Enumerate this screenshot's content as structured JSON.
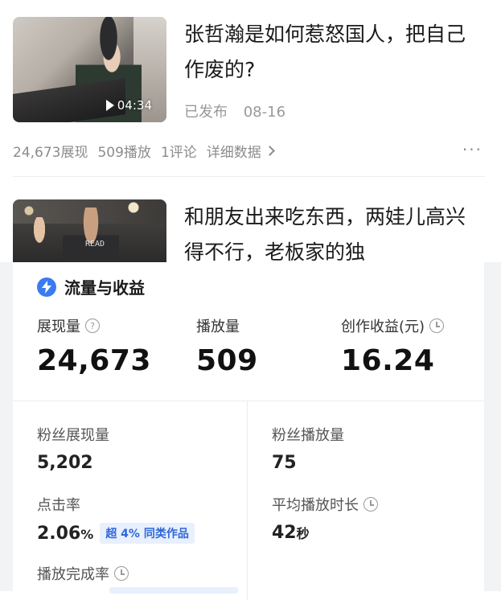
{
  "videos": [
    {
      "title": "张哲瀚是如何惹怒国人，把自己作废的?",
      "duration": "04:34",
      "status": "已发布",
      "date": "08-16",
      "stats": {
        "impressions": "24,673展现",
        "plays": "509播放",
        "comments": "1评论",
        "detail_link": "详细数据"
      },
      "more": "···"
    },
    {
      "title": "和朋友出来吃东西，两娃儿高兴得不行，老板家的独",
      "thumb_text": "READ"
    }
  ],
  "card": {
    "title": "流量与收益",
    "metrics": [
      {
        "label": "展现量",
        "value": "24,673",
        "icon": "help-circle-icon"
      },
      {
        "label": "播放量",
        "value": "509"
      },
      {
        "label": "创作收益(元)",
        "value": "16.24",
        "icon": "clock-icon"
      }
    ],
    "fan_impressions": {
      "label": "粉丝展现量",
      "value": "5,202"
    },
    "fan_plays": {
      "label": "粉丝播放量",
      "value": "75"
    },
    "ctr": {
      "label": "点击率",
      "value": "2.06",
      "unit": "%",
      "badge": "超 4% 同类作品"
    },
    "avg_play_time": {
      "label": "平均播放时长",
      "value": "42",
      "unit": "秒",
      "icon": "clock-icon"
    },
    "completion_rate": {
      "label": "播放完成率",
      "icon": "clock-icon"
    }
  },
  "colors": {
    "accent": "#3b7bf0",
    "badge_bg": "#e8f0fe",
    "badge_text": "#2f67d8"
  }
}
